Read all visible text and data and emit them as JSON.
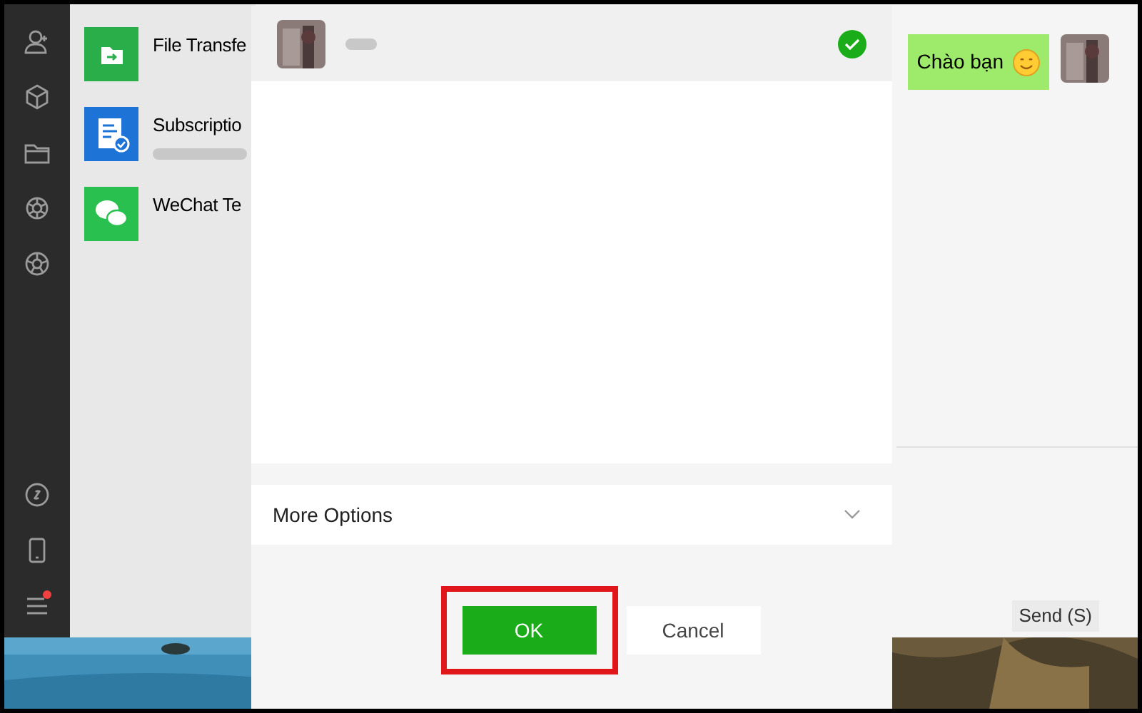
{
  "sidebar": {
    "menu_badge": true
  },
  "chats": [
    {
      "kind": "file",
      "title": "File Transfe",
      "has_subtitle": false
    },
    {
      "kind": "subscription",
      "title": "Subscriptio",
      "has_subtitle": true
    },
    {
      "kind": "wechat",
      "title": "WeChat Te",
      "has_subtitle": false
    }
  ],
  "message": {
    "text": "Chào bạn"
  },
  "send_button": "Send (S)",
  "dialog": {
    "contacts": [
      {
        "selected": true
      }
    ],
    "more_options": {
      "label": "More Options",
      "expanded": false
    },
    "buttons": [
      {
        "label": "OK",
        "kind": "primary",
        "highlighted": true
      },
      {
        "label": "Cancel",
        "kind": "secondary",
        "highlighted": false
      }
    ]
  }
}
